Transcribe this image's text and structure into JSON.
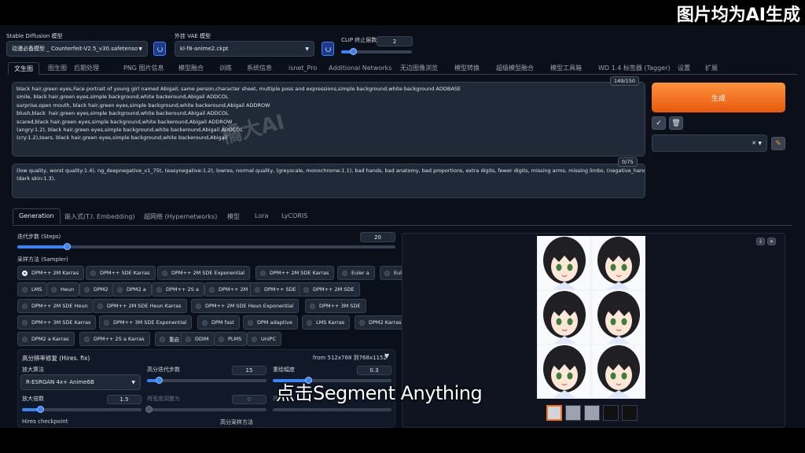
{
  "banner": {
    "title": "图片均为AI生成"
  },
  "top": {
    "model_label": "Stable Diffusion 模型",
    "model_value": "动漫必备模型 _ Counterfeit-V2.5_v30.safetensors",
    "vae_label": "外挂 VAE 模型",
    "vae_value": "kl-f8-anime2.ckpt",
    "clip_label": "CLIP 终止层数",
    "clip_value": "2",
    "clip_fraction": 0.17
  },
  "tabs": [
    "文生图",
    "图生图",
    "后期处理",
    "PNG 图片信息",
    "模型融合",
    "训练",
    "系统信息",
    "isnet_Pro",
    "Additional Networks",
    "无边图像浏览",
    "模型转换",
    "超级模型融合",
    "模型工具箱",
    "WD 1.4 标签器 (Tagger)",
    "设置",
    "扩展"
  ],
  "prompt": {
    "text": "black hair,green eyes,Face portrait of young girl named Abigail, same person,character sheet, multiple poss and expressions,simple background,white background ADDBASE\nsmile, black hair,green eyes,simple background,white backeround,Abigail ADDCOL\nsurprise,open mouth, black hair,green eyes,simple background,white backeround,Abigail ADDROW\nblush,black  hair,green eyes,simple background,white backeround,Abigail ADDCOL\nscared,black hair,green eyes,simple background,white backeround,Abigail ADDROW\n(angry:1.2), black hair,green eyes,simple background,white backeround,Abigail ADDCOL\n(cry:1.2),tears, black hair,green eyes,simple background,white backeround,Abigail",
    "counter": "149/150",
    "watermark": "橘大AI"
  },
  "negative": {
    "text": "(low quality, worst quality:1.4), ng_deepnegative_v1_75t, (easynegative:1.2), lowres, normal quality, (greyscale, monochrome:1.1), bad hands, bad anatomy, bad proportions, extra digits, fewer digits, missing arms, missing limbs, (negative_hand-neg:1.2),\n(dark skin:1.3),",
    "counter": "0/75"
  },
  "actions": {
    "generate": "生成",
    "check_icon": "✓",
    "trash_icon": "🗑",
    "clear_icon": "✕",
    "pencil_icon": "✎"
  },
  "subtabs": [
    "Generation",
    "嵌入式(T.I. Embedding)",
    "超网络 (Hypernetworks)",
    "模型",
    "Lora",
    "LyCORIS"
  ],
  "steps": {
    "label": "迭代步数 (Steps)",
    "value": "20",
    "fraction": 0.13
  },
  "sampler": {
    "label": "采样方法 (Sampler)",
    "selected": "DPM++ 2M Karras",
    "options": [
      [
        "DPM++ 2M Karras",
        "DPM++ SDE Karras",
        "DPM++ 2M SDE Exponential",
        "DPM++ 2M SDE Karras",
        "Euler a",
        "Euler"
      ],
      [
        "LMS",
        "Heun",
        "DPM2",
        "DPM2 a",
        "DPM++ 2S a",
        "DPM++ 2M",
        "DPM++ SDE",
        "DPM++ 2M SDE"
      ],
      [
        "DPM++ 2M SDE Heun",
        "DPM++ 2M SDE Heun Karras",
        "DPM++ 2M SDE Heun Exponential",
        "DPM++ 3M SDE"
      ],
      [
        "DPM++ 3M SDE Karras",
        "DPM++ 3M SDE Exponential",
        "DPM fast",
        "DPM adaptive",
        "LMS Karras",
        "DPM2 Karras"
      ],
      [
        "DPM2 a Karras",
        "DPM++ 2S a Karras",
        "重启",
        "DDIM",
        "PLMS",
        "UniPC"
      ]
    ]
  },
  "hires": {
    "title": "高分辨率修复 (Hires. fix)",
    "resize_note": "from 512x768 到768x1152",
    "upscaler_label": "放大算法",
    "upscaler_value": "R-ESRGAN 4x+ Anime6B",
    "steps_label": "高分迭代步数",
    "steps_value": "15",
    "steps_fraction": 0.1,
    "denoise_label": "重绘幅度",
    "denoise_value": "0.3",
    "denoise_fraction": 0.3,
    "scale_label": "放大倍数",
    "scale_value": "1.5",
    "scale_fraction": 0.15,
    "width_label": "将宽度调整为",
    "width_value": "0",
    "height_label": "将",
    "checkpoint_label": "Hires checkpoint",
    "sampler_label": "高分采样方法"
  },
  "gallery": {
    "subtitle": "点击Segment Anything"
  }
}
